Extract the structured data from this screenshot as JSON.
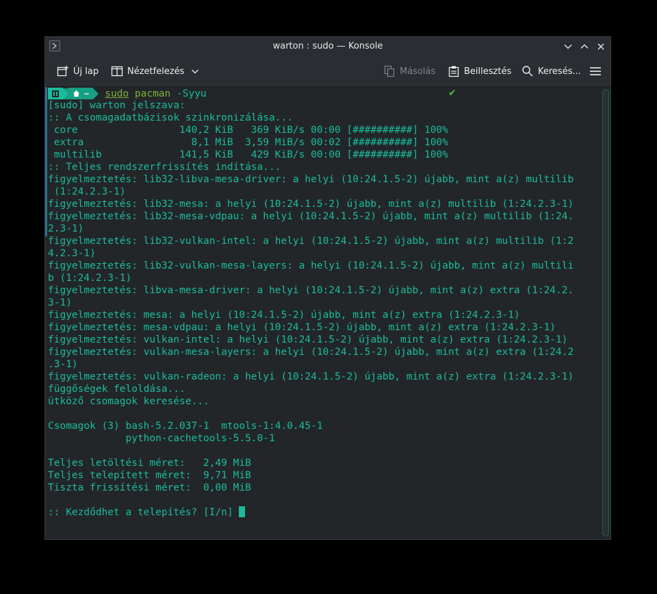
{
  "window": {
    "title": "warton : sudo — Konsole"
  },
  "toolbar": {
    "new_tab_label": "Új lap",
    "split_view_label": "Nézetfelezés",
    "copy_label": "Másolás",
    "paste_label": "Beillesztés",
    "search_label": "Keresés..."
  },
  "prompt": {
    "dir": "~",
    "cmd_sudo": "sudo",
    "cmd_pacman": "pacman",
    "cmd_args": "-Syyu",
    "status": "✔"
  },
  "terminal": {
    "lines": [
      "[sudo] warton jelszava:",
      ":: A csomagadatbázisok szinkronizálása...",
      " core                 140,2 KiB   369 KiB/s 00:00 [##########] 100%",
      " extra                  8,1 MiB  3,59 MiB/s 00:02 [##########] 100%",
      " multilib             141,5 KiB   429 KiB/s 00:00 [##########] 100%",
      ":: Teljes rendszerfrissítés indítása...",
      "figyelmeztetés: lib32-libva-mesa-driver: a helyi (10:24.1.5-2) újabb, mint a(z) multilib",
      " (1:24.2.3-1)",
      "figyelmeztetés: lib32-mesa: a helyi (10:24.1.5-2) újabb, mint a(z) multilib (1:24.2.3-1)",
      "figyelmeztetés: lib32-mesa-vdpau: a helyi (10:24.1.5-2) újabb, mint a(z) multilib (1:24.",
      "2.3-1)",
      "figyelmeztetés: lib32-vulkan-intel: a helyi (10:24.1.5-2) újabb, mint a(z) multilib (1:2",
      "4.2.3-1)",
      "figyelmeztetés: lib32-vulkan-mesa-layers: a helyi (10:24.1.5-2) újabb, mint a(z) multili",
      "b (1:24.2.3-1)",
      "figyelmeztetés: libva-mesa-driver: a helyi (10:24.1.5-2) újabb, mint a(z) extra (1:24.2.",
      "3-1)",
      "figyelmeztetés: mesa: a helyi (10:24.1.5-2) újabb, mint a(z) extra (1:24.2.3-1)",
      "figyelmeztetés: mesa-vdpau: a helyi (10:24.1.5-2) újabb, mint a(z) extra (1:24.2.3-1)",
      "figyelmeztetés: vulkan-intel: a helyi (10:24.1.5-2) újabb, mint a(z) extra (1:24.2.3-1)",
      "figyelmeztetés: vulkan-mesa-layers: a helyi (10:24.1.5-2) újabb, mint a(z) extra (1:24.2",
      ".3-1)",
      "figyelmeztetés: vulkan-radeon: a helyi (10:24.1.5-2) újabb, mint a(z) extra (1:24.2.3-1)",
      "függőségek feloldása...",
      "ütköző csomagok keresése...",
      "",
      "Csomagok (3) bash-5.2.037-1  mtools-1:4.0.45-1",
      "             python-cachetools-5.5.0-1",
      "",
      "Teljes letöltési méret:   2,49 MiB",
      "Teljes telepített méret:  9,71 MiB",
      "Tiszta frissítési méret:  0,00 MiB",
      ""
    ],
    "final_prompt": ":: Kezdődhet a telepítés? [I/n] "
  },
  "colors": {
    "terminal_fg": "#1abc9c",
    "command_green": "#7daf36",
    "background": "#232629",
    "titlebar": "#2a2e32"
  }
}
